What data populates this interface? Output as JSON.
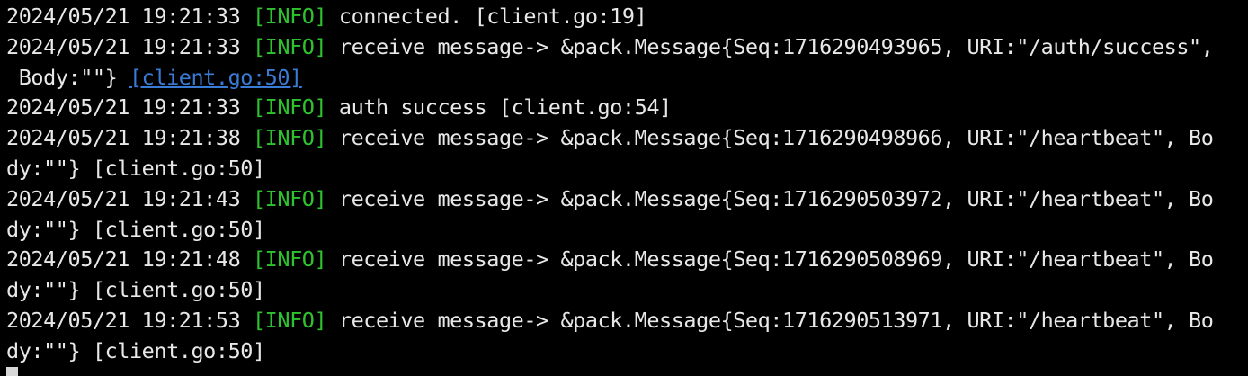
{
  "colors": {
    "background": "#000000",
    "text": "#e8e8e8",
    "info_tag": "#2ec32e",
    "link": "#3a7bd5",
    "cursor": "#d8d8d8"
  },
  "lines": [
    {
      "ts": "2024/05/21 19:21:33 ",
      "tag": "[INFO]",
      "msg": " connected. [client.go:19]"
    },
    {
      "ts": "2024/05/21 19:21:33 ",
      "tag": "[INFO]",
      "msg": " receive message-> &pack.Message{Seq:1716290493965, URI:\"/auth/success\","
    },
    {
      "cont": " Body:\"\"} ",
      "link": "[client.go:50]"
    },
    {
      "ts": "2024/05/21 19:21:33 ",
      "tag": "[INFO]",
      "msg": " auth success [client.go:54]"
    },
    {
      "ts": "2024/05/21 19:21:38 ",
      "tag": "[INFO]",
      "msg": " receive message-> &pack.Message{Seq:1716290498966, URI:\"/heartbeat\", Bo"
    },
    {
      "cont": "dy:\"\"} [client.go:50]"
    },
    {
      "ts": "2024/05/21 19:21:43 ",
      "tag": "[INFO]",
      "msg": " receive message-> &pack.Message{Seq:1716290503972, URI:\"/heartbeat\", Bo"
    },
    {
      "cont": "dy:\"\"} [client.go:50]"
    },
    {
      "ts": "2024/05/21 19:21:48 ",
      "tag": "[INFO]",
      "msg": " receive message-> &pack.Message{Seq:1716290508969, URI:\"/heartbeat\", Bo"
    },
    {
      "cont": "dy:\"\"} [client.go:50]"
    },
    {
      "ts": "2024/05/21 19:21:53 ",
      "tag": "[INFO]",
      "msg": " receive message-> &pack.Message{Seq:1716290513971, URI:\"/heartbeat\", Bo"
    },
    {
      "cont": "dy:\"\"} [client.go:50]"
    }
  ]
}
